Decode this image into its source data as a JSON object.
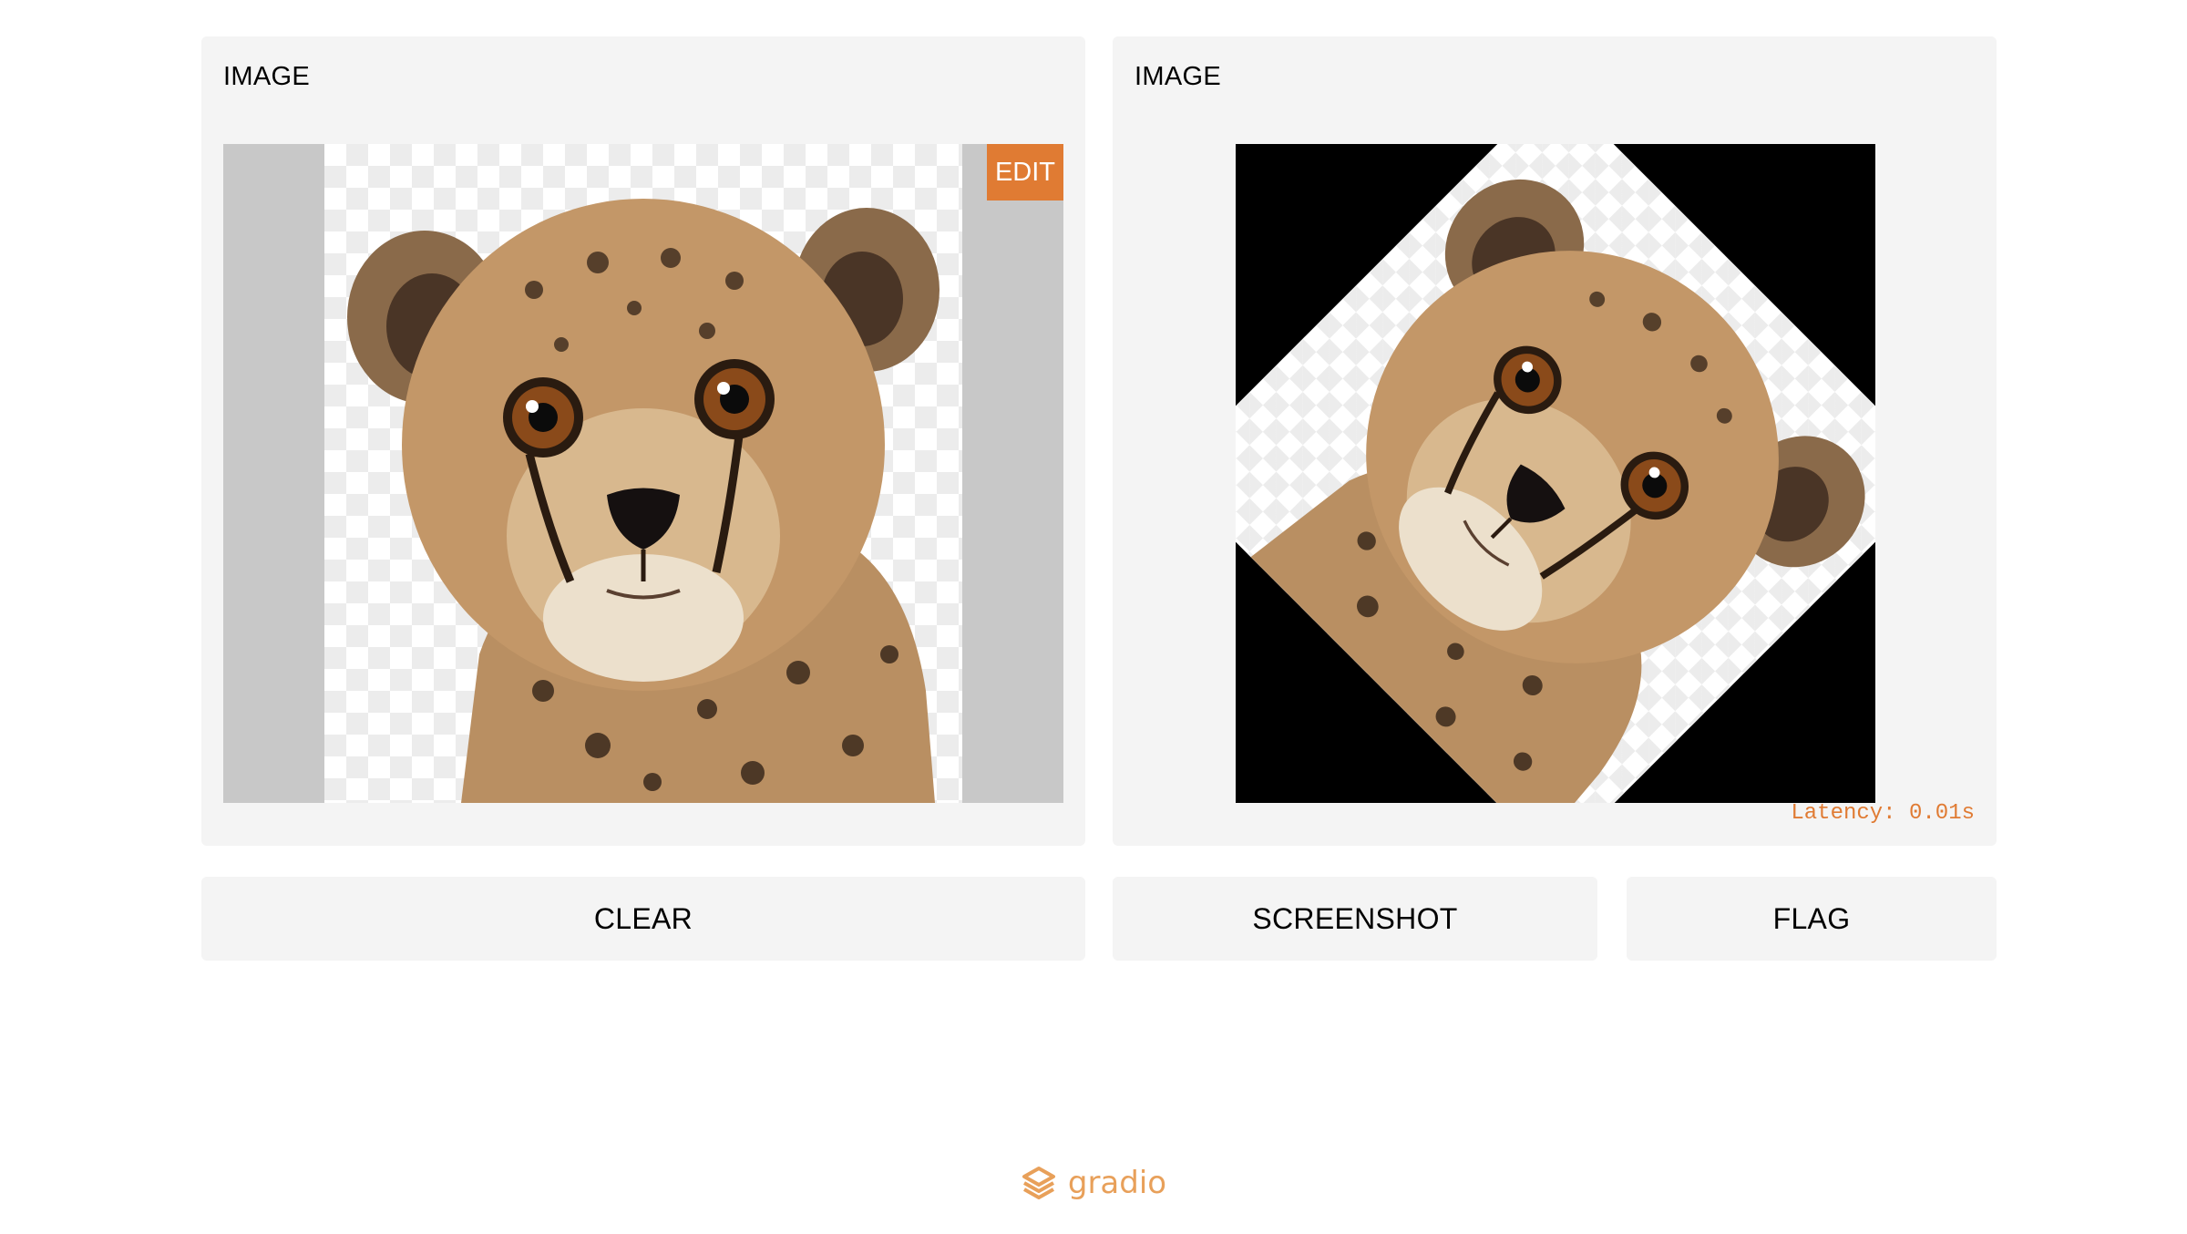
{
  "input_panel": {
    "label": "IMAGE",
    "edit_label": "EDIT"
  },
  "output_panel": {
    "label": "IMAGE",
    "latency": "Latency: 0.01s"
  },
  "buttons": {
    "clear": "CLEAR",
    "screenshot": "SCREENSHOT",
    "flag": "FLAG"
  },
  "footer": {
    "brand": "gradio"
  },
  "colors": {
    "accent": "#e07b33",
    "panel_bg": "#f4f4f4",
    "letterbox": "#c8c8c8"
  }
}
